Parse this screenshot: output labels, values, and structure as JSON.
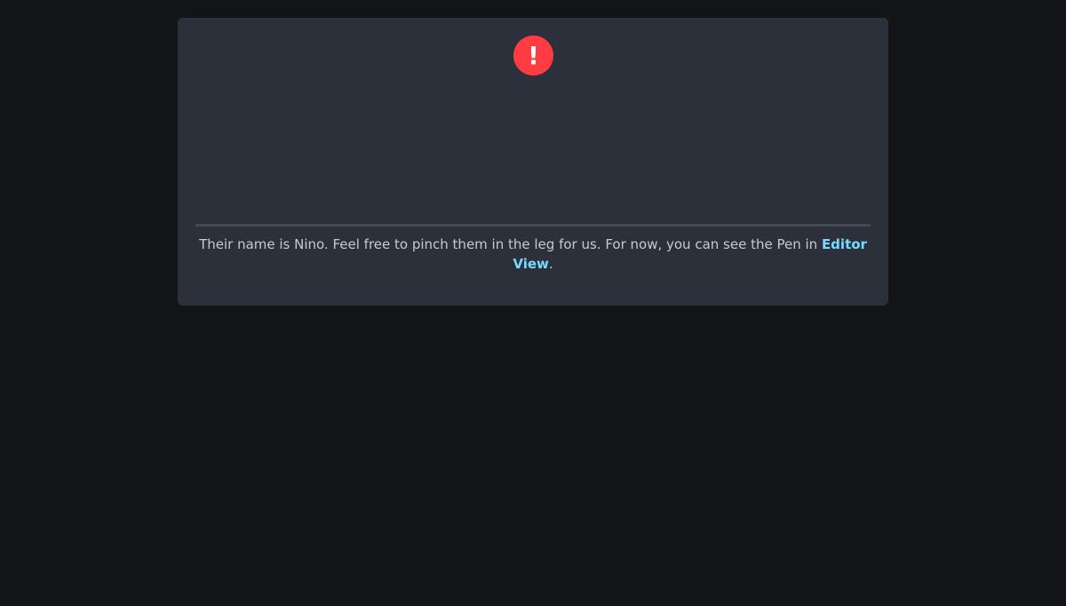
{
  "colors": {
    "page_background": "#131417",
    "panel_background": "#2c303a",
    "alert": "#ff3c41",
    "divider": "#444857",
    "text": "#c7c9d3",
    "link": "#76daff"
  },
  "alert": {
    "icon": "exclamation-icon",
    "glyph": "!"
  },
  "message": {
    "text": "Their name is Nino. Feel free to pinch them in the leg for us. For now, you can see the Pen in ",
    "link_label": "Editor View",
    "suffix": "."
  }
}
